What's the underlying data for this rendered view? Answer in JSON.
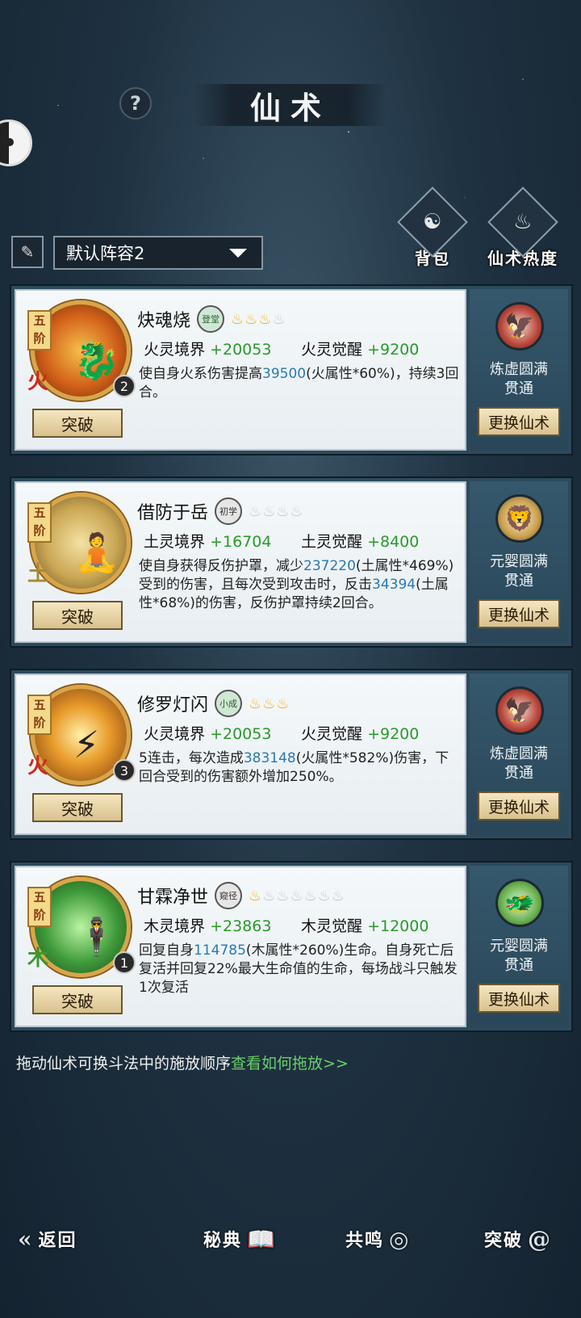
{
  "header": {
    "title": "仙术",
    "help": "?"
  },
  "side_buttons": [
    {
      "label": "背包",
      "icon": "bag-icon"
    },
    {
      "label": "仙术热度",
      "icon": "book-fire-icon"
    }
  ],
  "lineup": {
    "label": "默认阵容2"
  },
  "skills": [
    {
      "tier": "五阶",
      "element": "火",
      "level": "2",
      "name": "炔魂烧",
      "rank": "登堂",
      "flames_on": 3,
      "flames_total": 4,
      "stat1_label": "火灵境界",
      "stat1_value": "+20053",
      "stat2_label": "火灵觉醒",
      "stat2_value": "+9200",
      "desc_a": "使自身火系伤害提高",
      "desc_num1": "39500",
      "desc_b": "(火属性*60%)，持续3回合。",
      "realm_line1": "炼虚圆满",
      "realm_line2": "贯通",
      "break_label": "突破",
      "swap_label": "更换仙术"
    },
    {
      "tier": "五阶",
      "element": "土",
      "level": "",
      "name": "借防于岳",
      "rank": "初学",
      "flames_on": 0,
      "flames_total": 4,
      "stat1_label": "土灵境界",
      "stat1_value": "+16704",
      "stat2_label": "土灵觉醒",
      "stat2_value": "+8400",
      "desc_a": "使自身获得反伤护罩，减少",
      "desc_num1": "237220",
      "desc_b": "(土属性*469%)受到的伤害，且每次受到攻击时，反击",
      "desc_num2": "34394",
      "desc_c": "(土属性*68%)的伤害，反伤护罩持续2回合。",
      "realm_line1": "元婴圆满",
      "realm_line2": "贯通",
      "break_label": "突破",
      "swap_label": "更换仙术"
    },
    {
      "tier": "五阶",
      "element": "火",
      "level": "3",
      "name": "修罗灯闪",
      "rank": "小成",
      "flames_on": 3,
      "flames_total": 3,
      "stat1_label": "火灵境界",
      "stat1_value": "+20053",
      "stat2_label": "火灵觉醒",
      "stat2_value": "+9200",
      "desc_a": "5连击，每次造成",
      "desc_num1": "383148",
      "desc_b": "(火属性*582%)伤害，下回合受到的伤害额外增加250%。",
      "realm_line1": "炼虚圆满",
      "realm_line2": "贯通",
      "break_label": "突破",
      "swap_label": "更换仙术"
    },
    {
      "tier": "五阶",
      "element": "木",
      "level": "1",
      "name": "甘霖净世",
      "rank": "窥径",
      "flames_on": 1,
      "flames_total": 7,
      "stat1_label": "木灵境界",
      "stat1_value": "+23863",
      "stat2_label": "木灵觉醒",
      "stat2_value": "+12000",
      "desc_a": "回复自身",
      "desc_num1": "114785",
      "desc_b": "(木属性*260%)生命。自身死亡后复活并回复22%最大生命值的生命，每场战斗只触发1次复活",
      "realm_line1": "元婴圆满",
      "realm_line2": "贯通",
      "break_label": "突破",
      "swap_label": "更换仙术"
    }
  ],
  "hint": {
    "text": "拖动仙术可换斗法中的施放顺序",
    "link": "查看如何拖放>>"
  },
  "nav": [
    {
      "label": "返回",
      "icon": "back-arrow-icon"
    },
    {
      "label": "秘典",
      "icon": "book-icon"
    },
    {
      "label": "共鸣",
      "icon": "swirl-icon"
    },
    {
      "label": "突破",
      "icon": "spiral-icon"
    }
  ]
}
